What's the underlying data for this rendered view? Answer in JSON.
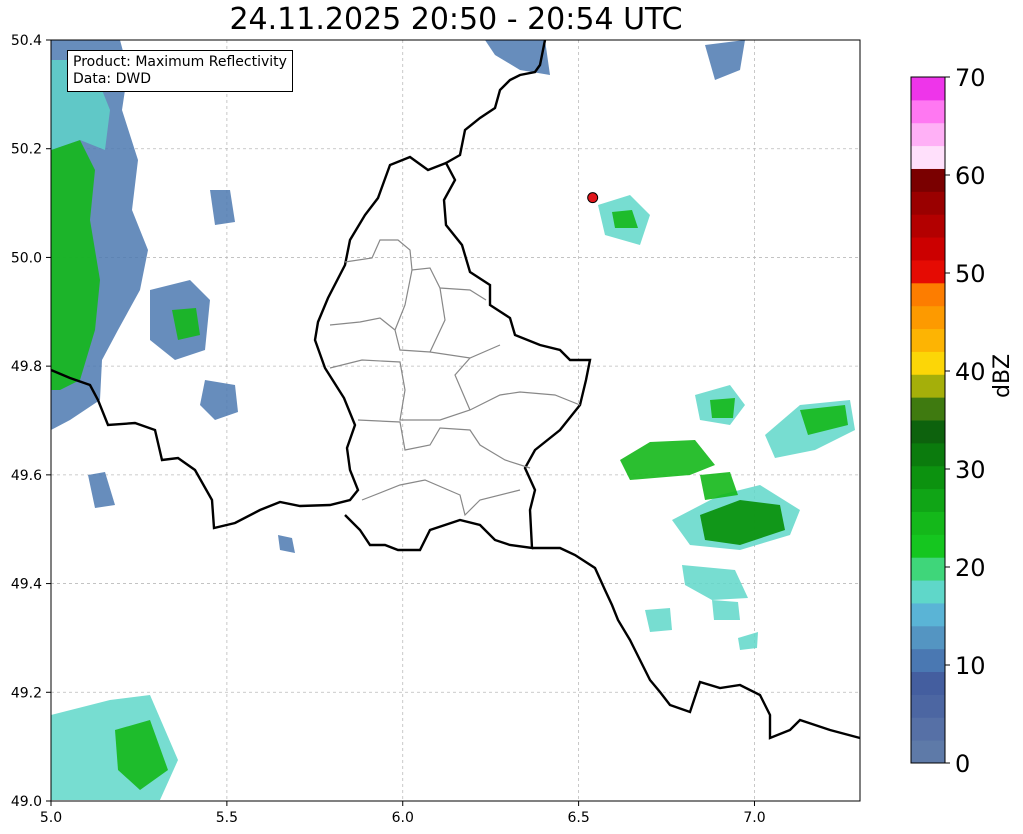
{
  "title": "24.11.2025 20:50 - 20:54 UTC",
  "info": {
    "product": "Product: Maximum Reflectivity",
    "source": "Data: DWD"
  },
  "map": {
    "lon_range": [
      5.0,
      7.3
    ],
    "lat_range": [
      49.0,
      50.4
    ],
    "x_ticks": [
      "5.0",
      "5.5",
      "6.0",
      "6.5",
      "7.0"
    ],
    "y_ticks": [
      "49.0",
      "49.2",
      "49.4",
      "49.6",
      "49.8",
      "50.0",
      "50.2",
      "50.4"
    ],
    "grid": true,
    "marker": {
      "lon": 6.54,
      "lat": 50.11,
      "color": "#e0161b"
    }
  },
  "colorbar": {
    "label": "dBZ",
    "ticks": [
      "0",
      "10",
      "20",
      "30",
      "40",
      "50",
      "60",
      "70"
    ],
    "colors": [
      "#5e7aa8",
      "#5670a6",
      "#4c66a2",
      "#445e9f",
      "#4a78b2",
      "#5495c2",
      "#5ab4d6",
      "#5fd7c9",
      "#3fd67a",
      "#15c61f",
      "#14b81a",
      "#10a516",
      "#0c920f",
      "#0b7b0d",
      "#0d620d",
      "#3f7a10",
      "#a5af0a",
      "#fcd607",
      "#fdb403",
      "#fd9a00",
      "#fd7d00",
      "#e50b03",
      "#cc0000",
      "#b30000",
      "#9a0000",
      "#7a0000",
      "#ffe0fb",
      "#ffb0f6",
      "#ff78f2",
      "#ee35ea"
    ]
  }
}
